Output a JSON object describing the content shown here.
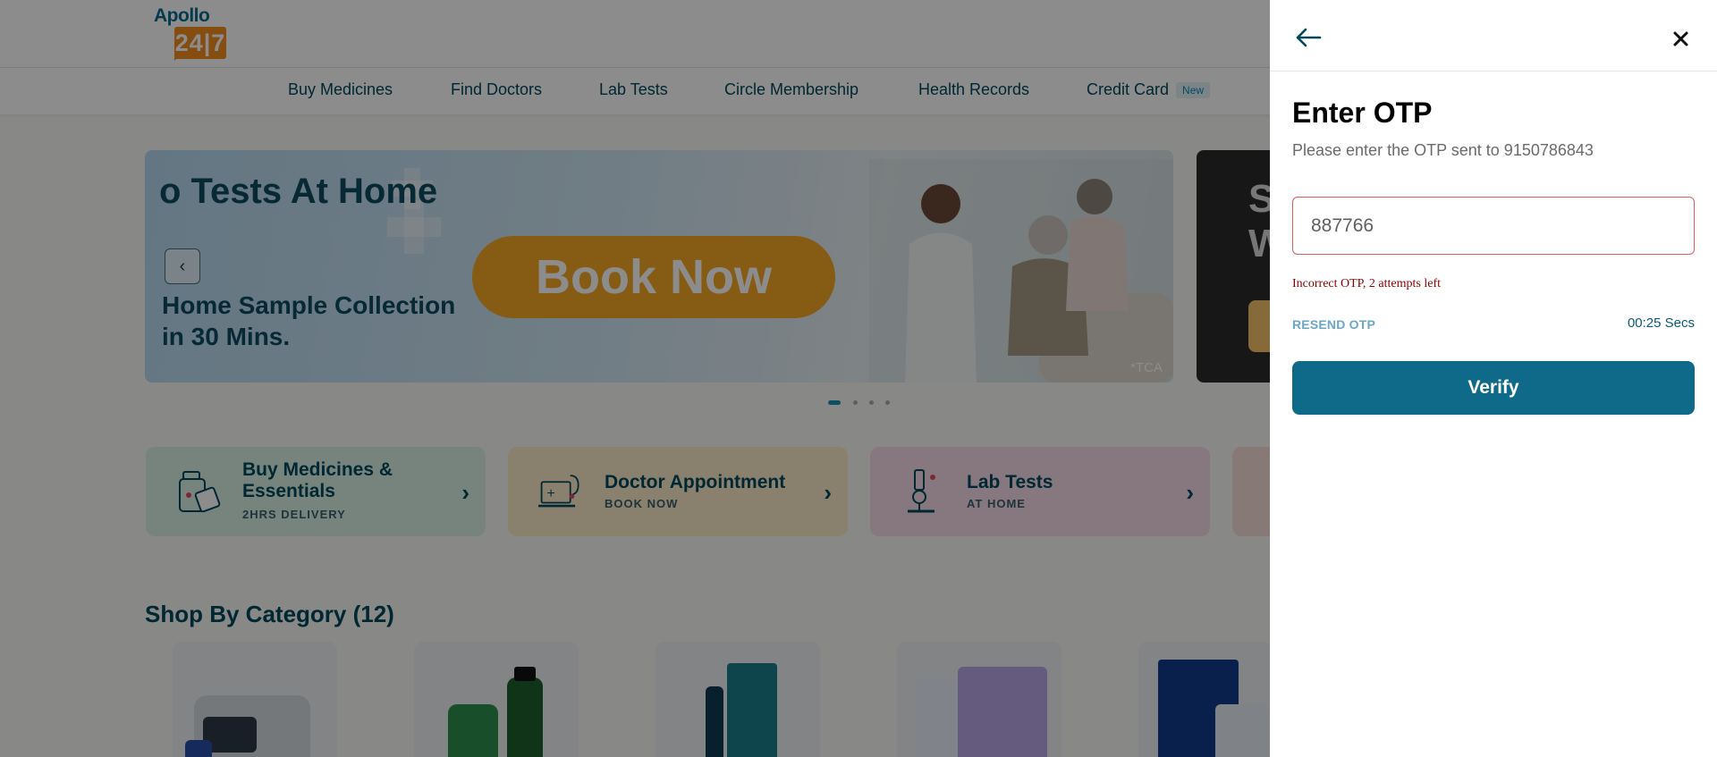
{
  "header": {
    "logo_word": "Apollo",
    "logo_number": "24|7"
  },
  "nav": {
    "items": [
      {
        "label": "Buy Medicines"
      },
      {
        "label": "Find Doctors"
      },
      {
        "label": "Lab Tests"
      },
      {
        "label": "Circle Membership"
      },
      {
        "label": "Health Records"
      },
      {
        "label": "Credit Card",
        "badge": "New"
      }
    ]
  },
  "banner": {
    "title": "o Tests At Home",
    "subtitle": "Home Sample Collection in 30 Mins.",
    "cta": "Book Now",
    "note": "*TCA",
    "next_banner_text": "S\nW"
  },
  "carousel": {
    "total": 4,
    "active": 1
  },
  "services": [
    {
      "title": "Buy Medicines & Essentials",
      "sub": "2HRS DELIVERY",
      "icon": "medicine-bottle-icon",
      "bg": "#d9f1e5"
    },
    {
      "title": "Doctor Appointment",
      "sub": "BOOK NOW",
      "icon": "doctor-laptop-icon",
      "bg": "#fbe9c8"
    },
    {
      "title": "Lab Tests",
      "sub": "AT HOME",
      "icon": "microscope-icon",
      "bg": "#f4dbe6"
    }
  ],
  "category_section": {
    "title": "Shop By Category (12)"
  },
  "otp_panel": {
    "title": "Enter OTP",
    "description": "Please enter the OTP sent to 9150786843",
    "otp_value": "887766",
    "error": "Incorrect OTP, 2 attempts left",
    "resend_label": "RESEND OTP",
    "timer": "00:25 Secs",
    "verify_label": "Verify",
    "back_icon": "arrow-left-icon",
    "close_icon": "close-icon"
  },
  "colors": {
    "brand_teal": "#02475b",
    "brand_orange": "#f28c1e",
    "verify_button": "#0e6a88",
    "error_text": "#8b0000",
    "input_error_border": "#e05a5a",
    "overlay": "rgba(0,0,0,0.45)"
  }
}
